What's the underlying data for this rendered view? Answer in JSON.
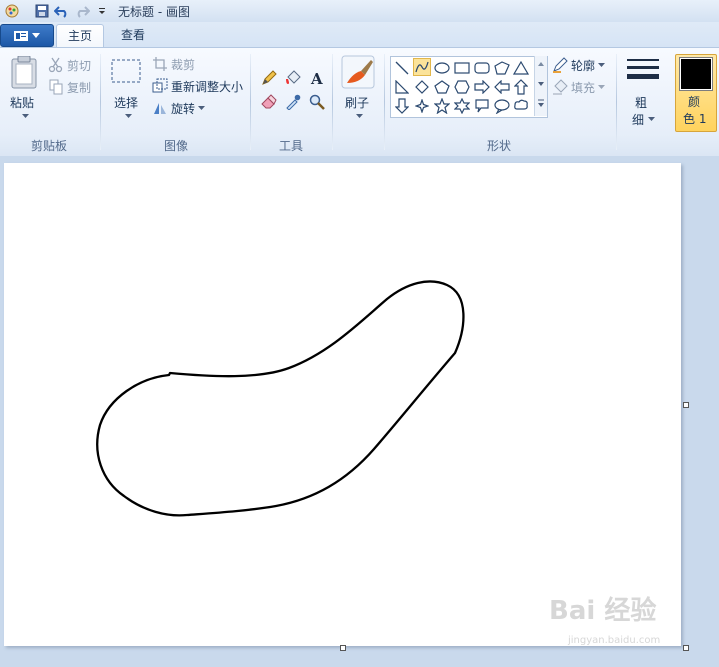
{
  "titlebar": {
    "title": "无标题 - 画图"
  },
  "tabs": {
    "home": "主页",
    "view": "查看"
  },
  "clipboard": {
    "paste": "粘贴",
    "cut": "剪切",
    "copy": "复制",
    "group": "剪贴板"
  },
  "image": {
    "select": "选择",
    "crop": "裁剪",
    "resize": "重新调整大小",
    "rotate": "旋转",
    "group": "图像"
  },
  "tools": {
    "group": "工具"
  },
  "brushes": {
    "label": "刷子"
  },
  "shapes": {
    "group": "形状",
    "outline": "轮廓",
    "fill": "填充"
  },
  "size": {
    "line1": "粗",
    "line2": "细"
  },
  "color1": {
    "line1": "颜",
    "line2": "色 1",
    "value": "#000000"
  },
  "watermark": {
    "brand": "Bai  经验",
    "url": "jingyan.baidu.com"
  }
}
